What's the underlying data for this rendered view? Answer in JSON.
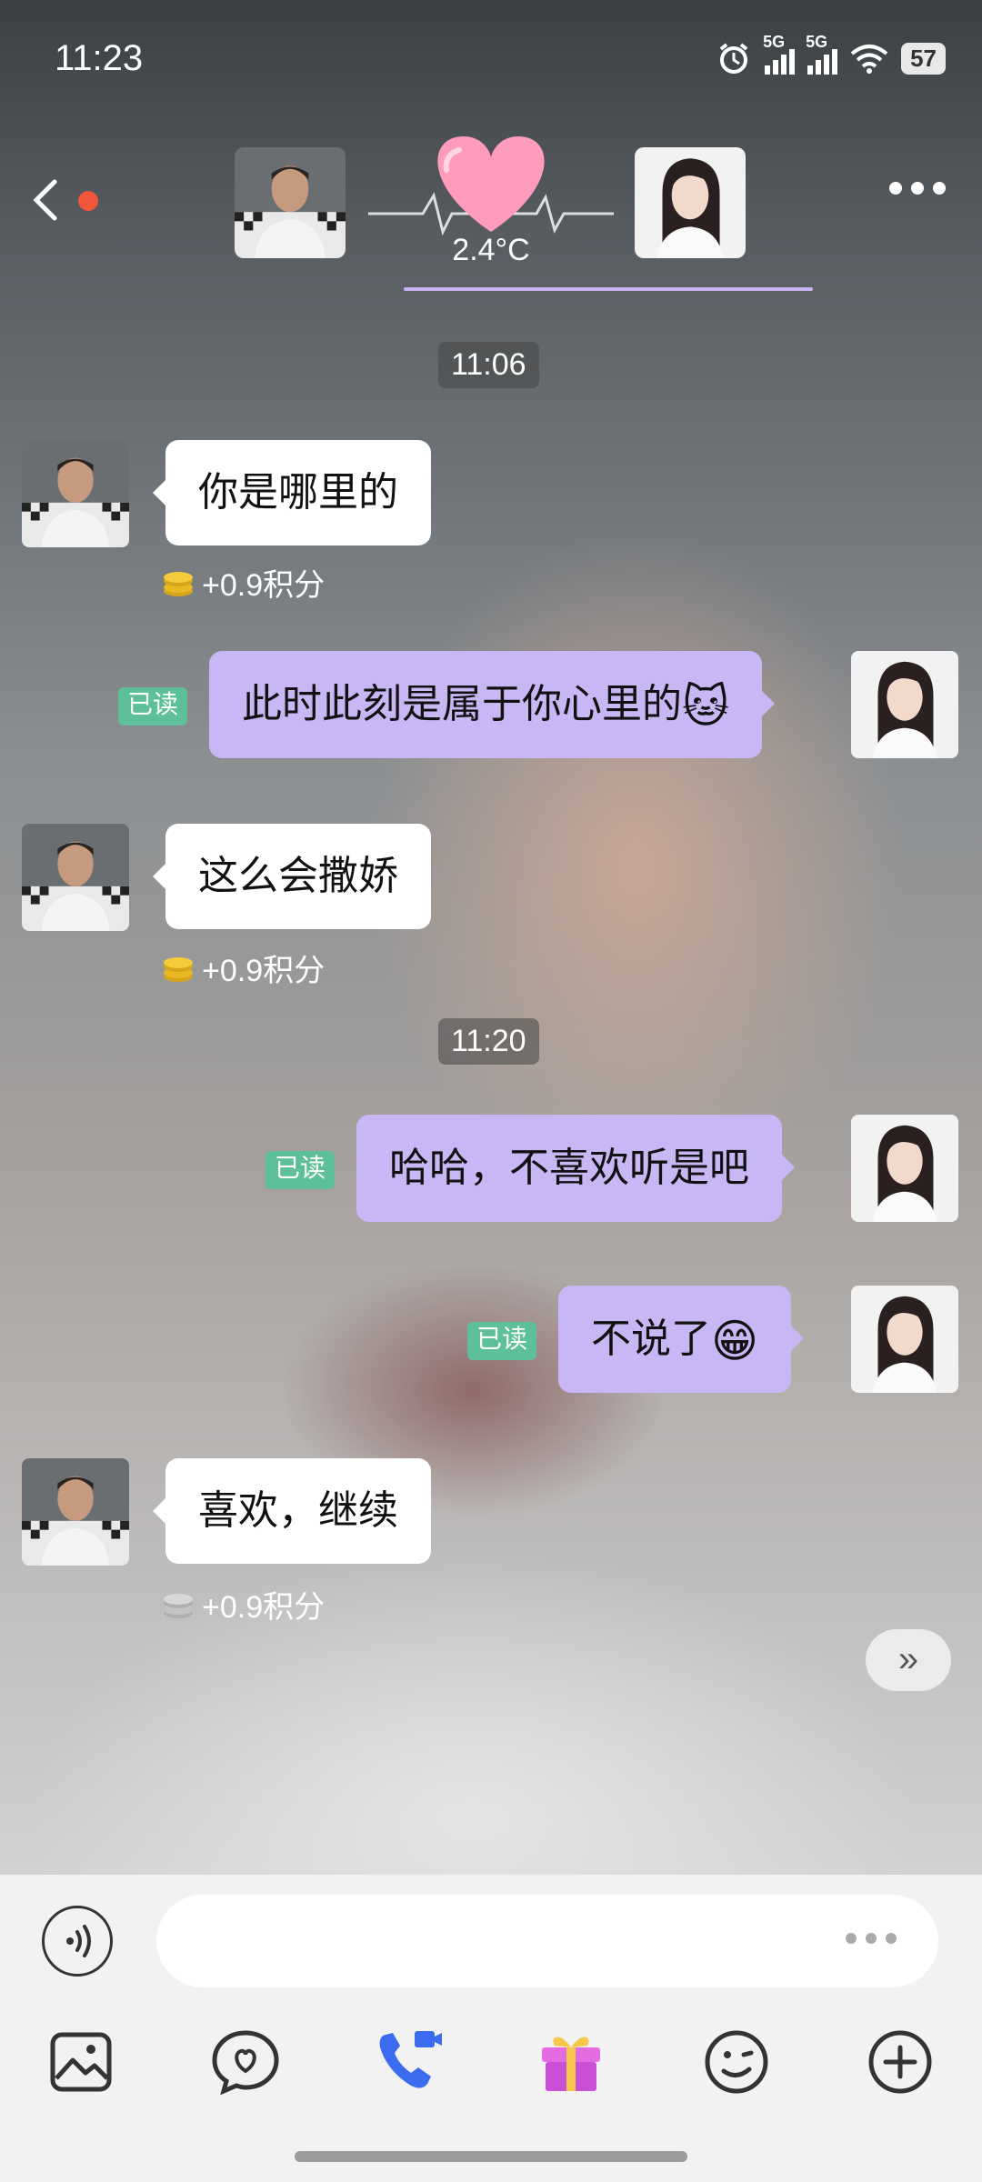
{
  "status_bar": {
    "time": "11:23",
    "network_1": "5G",
    "network_2": "5G",
    "battery": "57"
  },
  "header": {
    "temperature": "2.4°C"
  },
  "messages": [
    {
      "type": "time",
      "text": "11:06"
    },
    {
      "type": "incoming",
      "text": "你是哪里的",
      "points": "+0.9积分"
    },
    {
      "type": "outgoing",
      "text": "此时此刻是属于你心里的",
      "emoji": "🐱",
      "read": "已读"
    },
    {
      "type": "incoming",
      "text": "这么会撒娇",
      "points": "+0.9积分"
    },
    {
      "type": "time",
      "text": "11:20"
    },
    {
      "type": "outgoing",
      "text": "哈哈，不喜欢听是吧",
      "read": "已读"
    },
    {
      "type": "outgoing",
      "text": "不说了",
      "emoji": "😁",
      "read": "已读"
    },
    {
      "type": "incoming",
      "text": "喜欢，继续",
      "points": "+0.9积分"
    }
  ],
  "skip_label": "»",
  "colors": {
    "outgoing_bubble": "#c8b6f5",
    "incoming_bubble": "#ffffff",
    "read_badge": "#5dc09a",
    "gift_icon": "#d45ad8",
    "call_icon": "#3b6cf0",
    "red_dot": "#f2563a"
  },
  "toolbar": {
    "icons": [
      "image-icon",
      "heart-chat-icon",
      "video-call-icon",
      "gift-icon",
      "emoji-icon",
      "plus-icon"
    ]
  }
}
